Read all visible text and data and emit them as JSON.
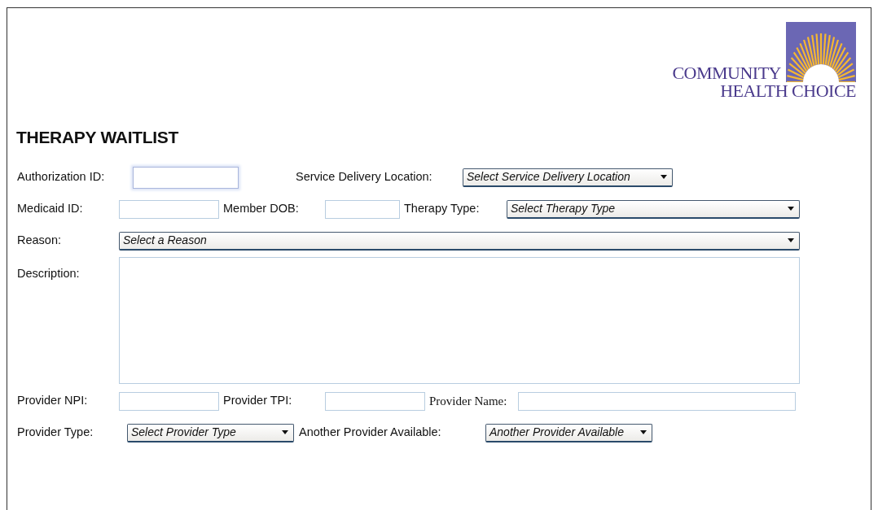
{
  "logo": {
    "line1": "COMMUNITY",
    "line2": "HEALTH CHOICE"
  },
  "title": "THERAPY WAITLIST",
  "rows": [
    {
      "items": [
        {
          "kind": "label",
          "text": "Authorization ID:"
        },
        {
          "kind": "input",
          "focused": true
        },
        {
          "kind": "label",
          "text": "Service Delivery Location:"
        },
        {
          "kind": "select",
          "text": "Select Service Delivery Location"
        }
      ]
    },
    {
      "items": [
        {
          "kind": "label",
          "text": "Medicaid ID:"
        },
        {
          "kind": "input",
          "focused": false
        },
        {
          "kind": "label",
          "text": "Member DOB:"
        },
        {
          "kind": "input",
          "focused": false
        },
        {
          "kind": "label",
          "text": "Therapy Type:"
        },
        {
          "kind": "select",
          "text": "Select Therapy Type"
        }
      ]
    },
    {
      "items": [
        {
          "kind": "label",
          "text": "Reason:"
        },
        {
          "kind": "select",
          "text": "Select a Reason"
        }
      ]
    },
    {
      "items": [
        {
          "kind": "label",
          "text": "Description:"
        },
        {
          "kind": "textarea"
        }
      ]
    },
    {
      "items": [
        {
          "kind": "label",
          "text": "Provider NPI:"
        },
        {
          "kind": "input",
          "focused": false
        },
        {
          "kind": "label",
          "text": "Provider TPI:"
        },
        {
          "kind": "input",
          "focused": false
        },
        {
          "kind": "serif-label",
          "text": "Provider Name:"
        },
        {
          "kind": "input",
          "focused": false
        }
      ]
    },
    {
      "items": [
        {
          "kind": "label",
          "text": "Provider Type:"
        },
        {
          "kind": "select",
          "text": "Select Provider Type"
        },
        {
          "kind": "label",
          "text": "Another Provider Available:"
        },
        {
          "kind": "select",
          "text": "Another Provider Available"
        }
      ]
    }
  ]
}
